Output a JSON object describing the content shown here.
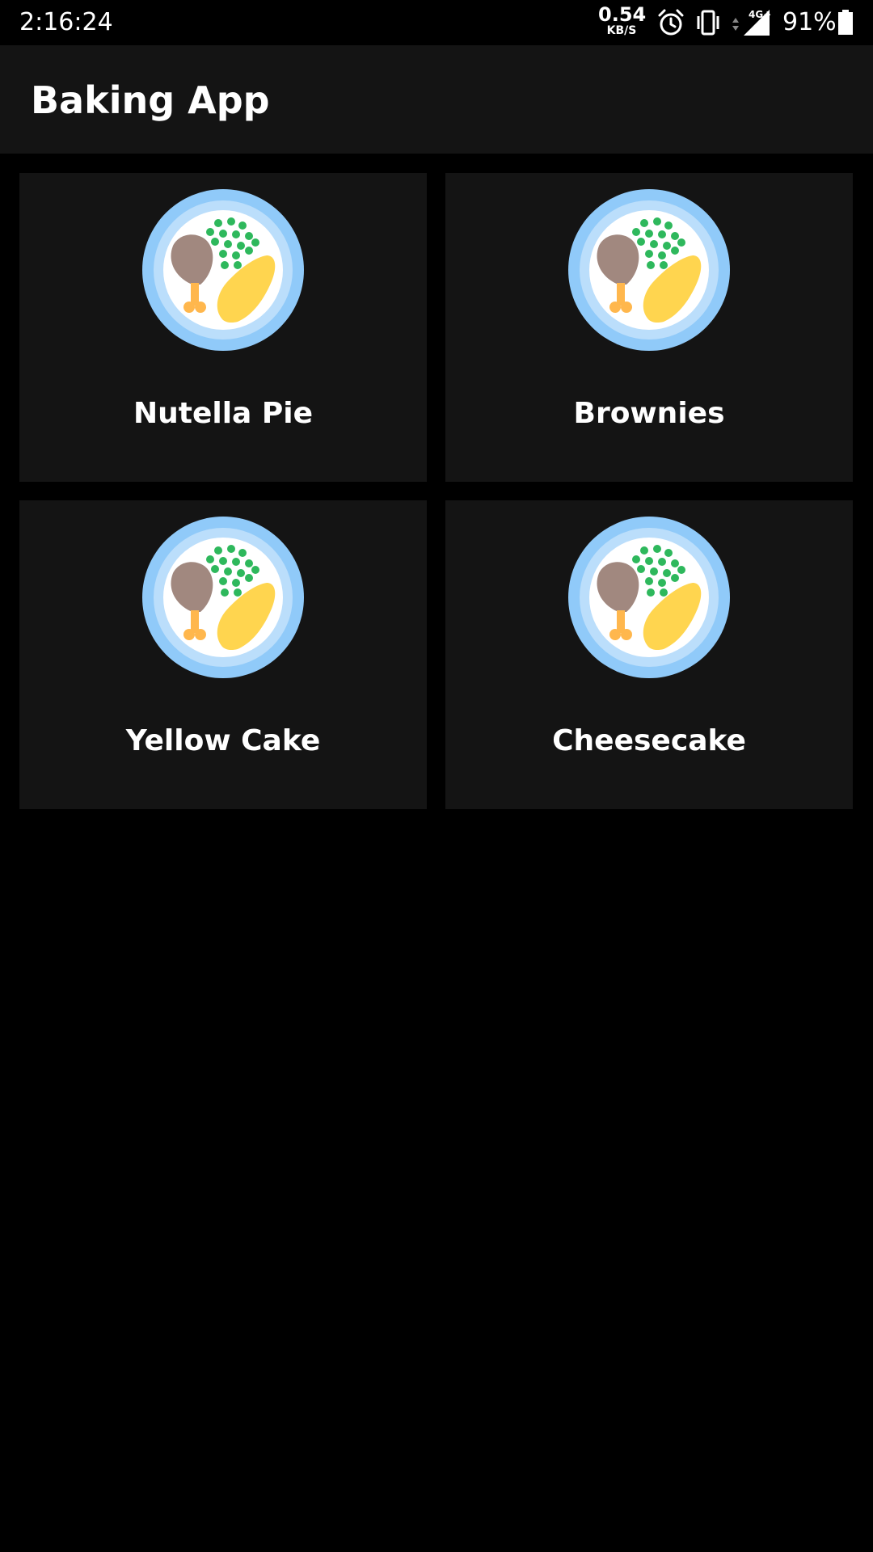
{
  "status_bar": {
    "time": "2:16:24",
    "net_speed_value": "0.54",
    "net_speed_unit": "KB/S",
    "network_type": "4G+",
    "battery_percent": "91%",
    "icons": [
      "alarm-icon",
      "vibrate-icon",
      "signal-icon",
      "battery-icon"
    ]
  },
  "app_bar": {
    "title": "Baking App",
    "background": "#141414"
  },
  "recipes": [
    {
      "name": "Nutella Pie",
      "icon": "food-plate-icon"
    },
    {
      "name": "Brownies",
      "icon": "food-plate-icon"
    },
    {
      "name": "Yellow Cake",
      "icon": "food-plate-icon"
    },
    {
      "name": "Cheesecake",
      "icon": "food-plate-icon"
    }
  ],
  "colors": {
    "background": "#000000",
    "card": "#141414",
    "plate_outer": "#90CAF9",
    "plate_inner": "#BBDEFB",
    "peas": "#2EB85C",
    "drumstick": "#A1887F",
    "bone": "#FFB74D",
    "potato": "#FFD54F"
  }
}
